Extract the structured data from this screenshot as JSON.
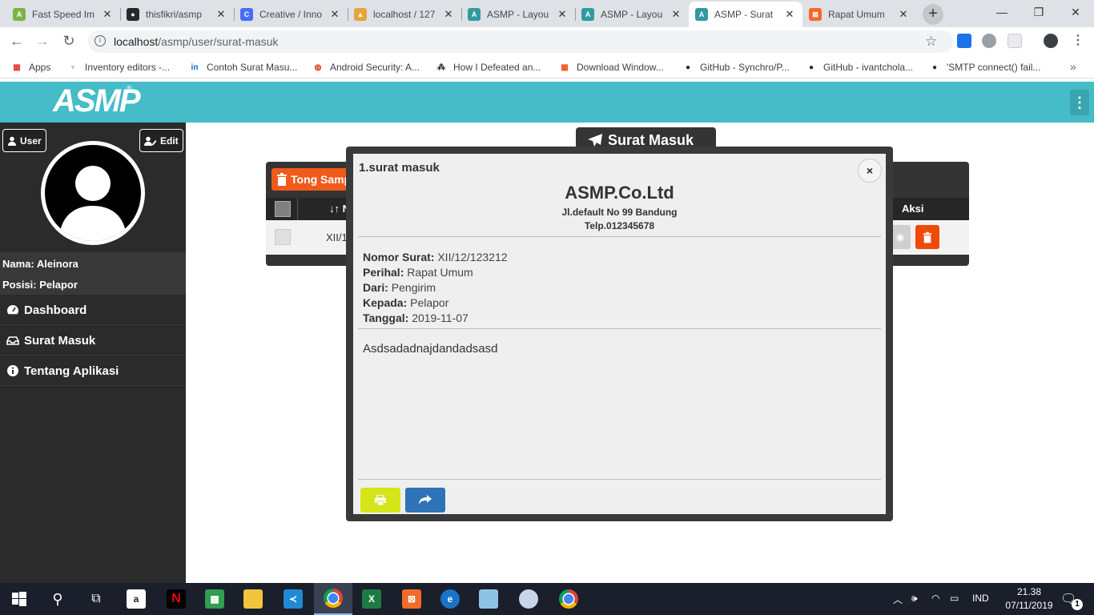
{
  "browser": {
    "tabs": [
      {
        "label": "Fast Speed Im",
        "color": "#7cb342",
        "glyph": "A"
      },
      {
        "label": "thisfikri/asmp",
        "color": "#24292e",
        "glyph": "●"
      },
      {
        "label": "Creative / Inno",
        "color": "#4a6cf7",
        "glyph": "C"
      },
      {
        "label": "localhost / 127",
        "color": "#e8a33d",
        "glyph": "▲"
      },
      {
        "label": "ASMP - Layou",
        "color": "#2f9aa0",
        "glyph": "A"
      },
      {
        "label": "ASMP - Layou",
        "color": "#2f9aa0",
        "glyph": "A"
      },
      {
        "label": "ASMP - Surat",
        "color": "#2f9aa0",
        "glyph": "A"
      },
      {
        "label": "Rapat Umum",
        "color": "#f26b2a",
        "glyph": "⊠"
      }
    ],
    "url_host": "localhost",
    "url_path": "/asmp/user/surat-masuk",
    "bookmarks": [
      {
        "label": "Apps",
        "color": "#e53935",
        "glyph": "▦"
      },
      {
        "label": "Inventory editors -...",
        "color": "#5d8a3a",
        "glyph": "♆"
      },
      {
        "label": "Contoh Surat Masu...",
        "color": "#0a66c2",
        "glyph": "in"
      },
      {
        "label": "Android Security: A...",
        "color": "#d84315",
        "glyph": "◍"
      },
      {
        "label": "How I Defeated an...",
        "color": "#222",
        "glyph": "⁂"
      },
      {
        "label": "Download Window...",
        "color": "#f25022",
        "glyph": "▦"
      },
      {
        "label": "GitHub - Synchro/P...",
        "color": "#24292e",
        "glyph": "●"
      },
      {
        "label": "GitHub - ivantchola...",
        "color": "#24292e",
        "glyph": "●"
      },
      {
        "label": "'SMTP connect() fail...",
        "color": "#24292e",
        "glyph": "●"
      }
    ]
  },
  "app": {
    "logo": "ASMP",
    "user_button": "User",
    "edit_button": "Edit",
    "name_line": "Nama: Aleinora",
    "position_line": "Posisi: Pelapor",
    "nav": [
      {
        "label": "Dashboard",
        "icon": "dashboard-icon"
      },
      {
        "label": "Surat Masuk",
        "icon": "inbox-icon"
      },
      {
        "label": "Tentang Aplikasi",
        "icon": "info-icon"
      }
    ],
    "page_title": "Surat Masuk",
    "trash_button": "Tong Samp",
    "table": {
      "sort_header": "↓↑ N",
      "action_header": "Aksi",
      "row_no": "XII/1"
    }
  },
  "modal": {
    "title": "1.surat masuk",
    "company": "ASMP.Co.Ltd",
    "address": "Jl.default No 99 Bandung",
    "phone": "Telp.012345678",
    "fields": [
      {
        "label": "Nomor Surat:",
        "value": "XII/12/123212"
      },
      {
        "label": "Perihal:",
        "value": "Rapat Umum"
      },
      {
        "label": "Dari:",
        "value": "Pengirim"
      },
      {
        "label": "Kepada:",
        "value": "Pelapor"
      },
      {
        "label": "Tanggal:",
        "value": "2019-11-07"
      }
    ],
    "body": "Asdsadadnajdandadsasd",
    "close_label": "×"
  },
  "taskbar": {
    "lang": "IND",
    "time": "21.38",
    "date": "07/11/2019",
    "notif": "1"
  },
  "colors": {
    "accent": "#45bcc7",
    "danger": "#f05a1a",
    "print": "#d6e51a",
    "forward": "#2e73b8"
  }
}
